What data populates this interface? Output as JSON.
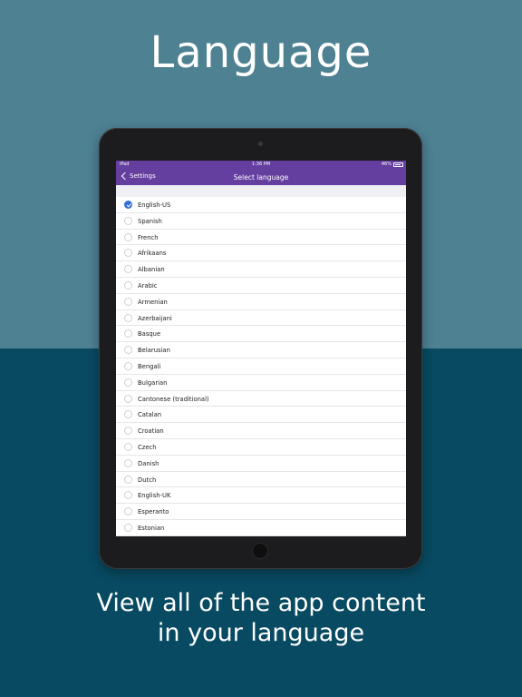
{
  "headline": "Language",
  "tagline": [
    "View all of the app content",
    "in your language"
  ],
  "statusbar": {
    "carrier": "iPad",
    "time": "1:36 PM",
    "battery": "46%"
  },
  "navbar": {
    "back_label": "Settings",
    "title": "Select language"
  },
  "colors": {
    "bg_top": "#4e8192",
    "bg_bottom": "#084a62",
    "nav": "#643fa0",
    "check": "#2f6fd6"
  },
  "languages": [
    {
      "label": "English-US",
      "selected": true
    },
    {
      "label": "Spanish",
      "selected": false
    },
    {
      "label": "French",
      "selected": false
    },
    {
      "label": "Afrikaans",
      "selected": false
    },
    {
      "label": "Albanian",
      "selected": false
    },
    {
      "label": "Arabic",
      "selected": false
    },
    {
      "label": "Armenian",
      "selected": false
    },
    {
      "label": "Azerbaijani",
      "selected": false
    },
    {
      "label": "Basque",
      "selected": false
    },
    {
      "label": "Belarusian",
      "selected": false
    },
    {
      "label": "Bengali",
      "selected": false
    },
    {
      "label": "Bulgarian",
      "selected": false
    },
    {
      "label": "Cantonese (traditional)",
      "selected": false
    },
    {
      "label": "Catalan",
      "selected": false
    },
    {
      "label": "Croatian",
      "selected": false
    },
    {
      "label": "Czech",
      "selected": false
    },
    {
      "label": "Danish",
      "selected": false
    },
    {
      "label": "Dutch",
      "selected": false
    },
    {
      "label": "English-UK",
      "selected": false
    },
    {
      "label": "Esperanto",
      "selected": false
    },
    {
      "label": "Estonian",
      "selected": false
    }
  ]
}
